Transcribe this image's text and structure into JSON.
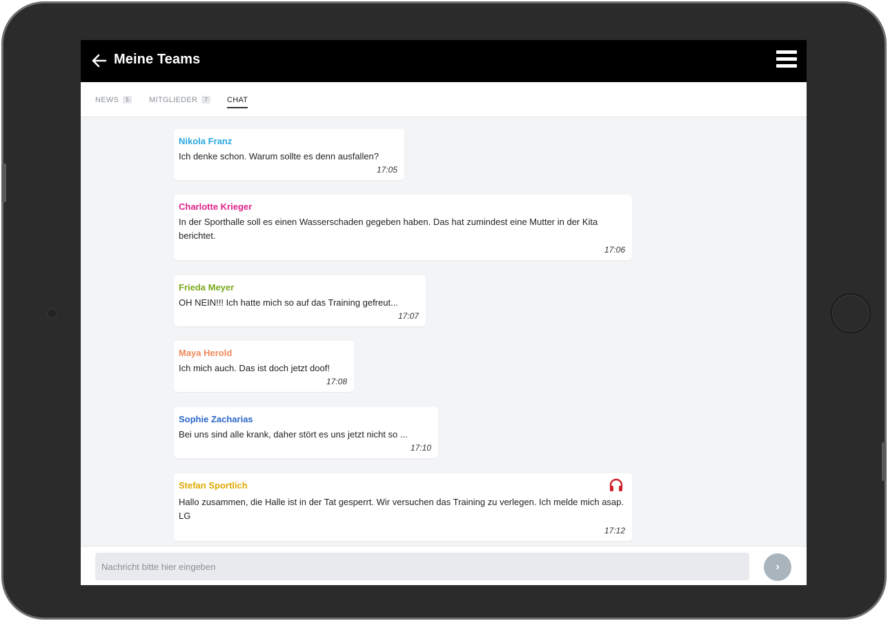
{
  "header": {
    "title": "Meine Teams",
    "back_icon": "arrow-left-icon",
    "menu_icon": "hamburger-menu-icon"
  },
  "tabs": [
    {
      "label": "NEWS",
      "badge": "5"
    },
    {
      "label": "MITGLIEDER",
      "badge": "7"
    },
    {
      "label": "CHAT",
      "active": true
    }
  ],
  "messages": [
    {
      "author": "Nikola Franz",
      "author_color": "#29a8e0",
      "text": "Ich denke schon. Warum sollte es denn ausfallen?",
      "time": "17:05"
    },
    {
      "author": "Charlotte Krieger",
      "author_color": "#e0218a",
      "text": "In der Sporthalle soll es einen Wasserschaden gegeben haben. Das hat zumindest eine Mutter in der Kita berichtet.",
      "time": "17:06"
    },
    {
      "author": "Frieda Meyer",
      "author_color": "#7aa81e",
      "text": "OH NEIN!!! Ich hatte mich so auf das Training gefreut...",
      "time": "17:07"
    },
    {
      "author": "Maya Herold",
      "author_color": "#f08a5a",
      "text": "Ich mich auch. Das ist doch jetzt doof!",
      "time": "17:08"
    },
    {
      "author": "Sophie Zacharias",
      "author_color": "#2966c8",
      "text": "Bei uns sind alle krank, daher stört es uns jetzt nicht so ...",
      "time": "17:10"
    },
    {
      "author": "Stefan Sportlich",
      "author_color": "#e0a800",
      "text": "Hallo zusammen, die Halle ist in der Tat gesperrt. Wir versuchen das Training zu verlegen. Ich melde mich asap. LG",
      "time": "17:12",
      "icon": "headset-icon",
      "icon_color": "#d0202a"
    }
  ],
  "composer": {
    "placeholder": "Nachricht bitte hier eingeben",
    "value": "",
    "send_icon": "chevron-right-icon",
    "send_symbol": "›"
  }
}
